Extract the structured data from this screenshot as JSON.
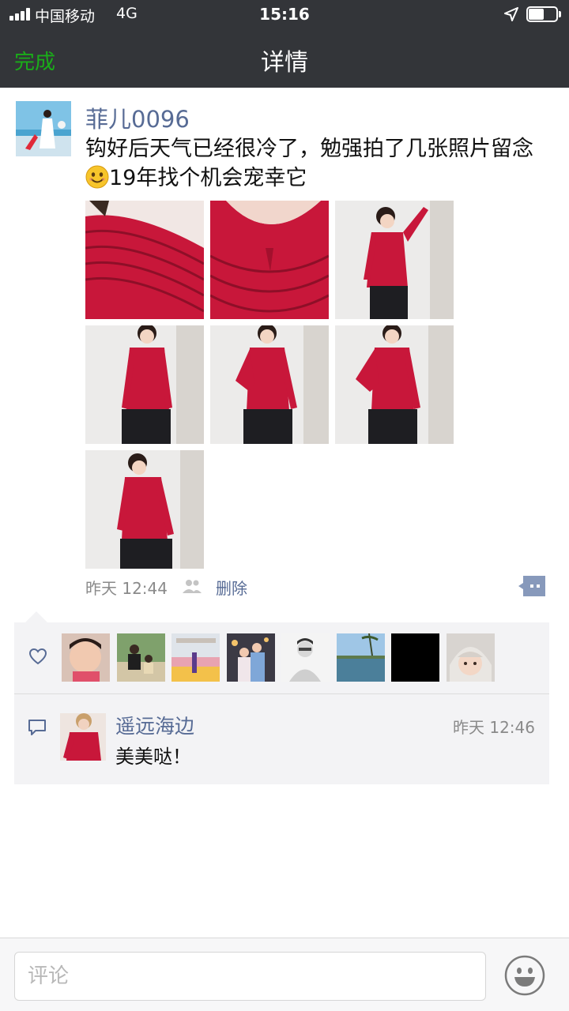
{
  "status_bar": {
    "carrier": "中国移动",
    "network": "4G",
    "time": "15:16",
    "icons": [
      "signal-icon",
      "location-icon",
      "battery-icon"
    ],
    "battery_level": 0.55
  },
  "nav": {
    "done_label": "完成",
    "title": "详情"
  },
  "post": {
    "username": "菲儿0096",
    "text_before_emoji": "钩好后天气已经很冷了，勉强拍了几张照片留念",
    "emoji": "smile-emoji",
    "text_after_emoji": "19年找个机会宠幸它",
    "photo_count": 7,
    "time": "昨天 12:44",
    "delete_label": "删除"
  },
  "likes": {
    "icon": "heart-icon",
    "liker_count": 8
  },
  "comments": [
    {
      "name": "遥远海边",
      "time": "昨天 12:46",
      "text": "美美哒！"
    }
  ],
  "comment_bar": {
    "placeholder": "评论",
    "emoji_icon": "emoji-face-icon"
  },
  "colors": {
    "accent_green": "#1AAD19",
    "link_blue": "#576B95",
    "header_bg": "#333539",
    "sweater_red": "#C8173A"
  }
}
